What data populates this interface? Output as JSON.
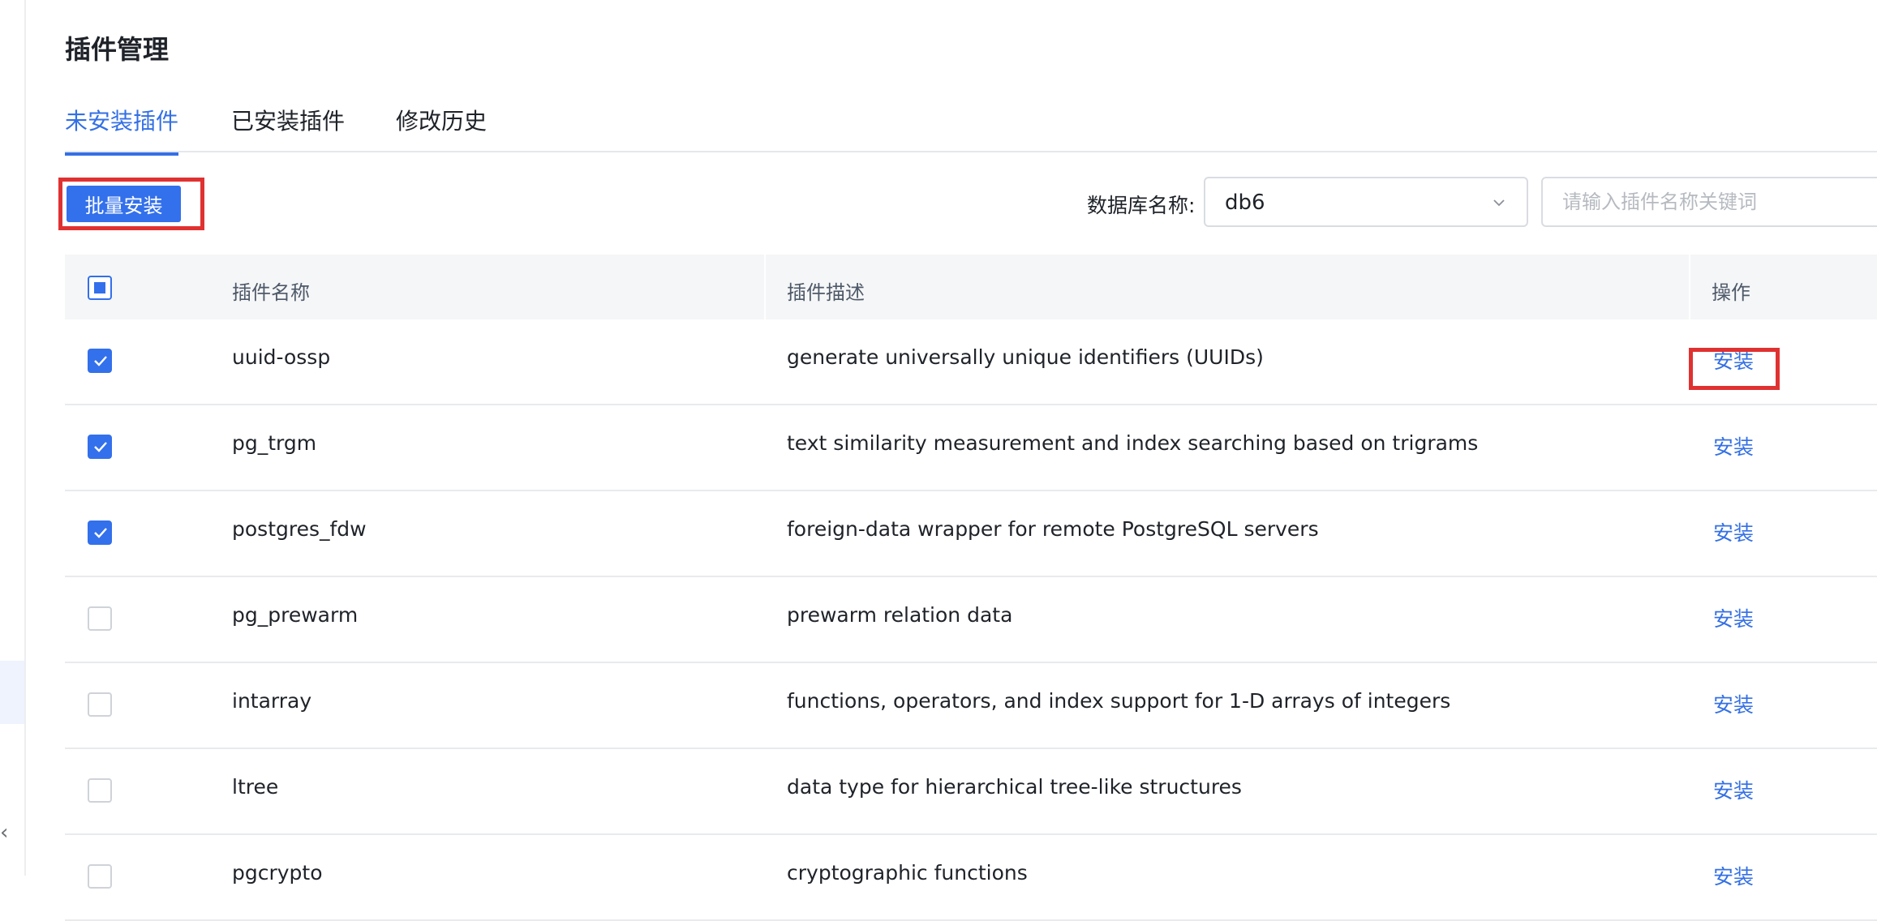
{
  "page": {
    "title": "插件管理"
  },
  "tabs": [
    {
      "label": "未安装插件",
      "active": true
    },
    {
      "label": "已安装插件",
      "active": false
    },
    {
      "label": "修改历史",
      "active": false
    }
  ],
  "toolbar": {
    "batch_install_label": "批量安装",
    "db_label": "数据库名称:",
    "db_value": "db6",
    "search_placeholder": "请输入插件名称关键词"
  },
  "table": {
    "headers": {
      "name": "插件名称",
      "desc": "插件描述",
      "op": "操作"
    },
    "header_checkbox_state": "partial",
    "rows": [
      {
        "name": "uuid-ossp",
        "desc": "generate universally unique identifiers (UUIDs)",
        "op": "安装",
        "checked": true
      },
      {
        "name": "pg_trgm",
        "desc": "text similarity measurement and index searching based on trigrams",
        "op": "安装",
        "checked": true
      },
      {
        "name": "postgres_fdw",
        "desc": "foreign-data wrapper for remote PostgreSQL servers",
        "op": "安装",
        "checked": true
      },
      {
        "name": "pg_prewarm",
        "desc": "prewarm relation data",
        "op": "安装",
        "checked": false
      },
      {
        "name": "intarray",
        "desc": "functions, operators, and index support for 1-D arrays of integers",
        "op": "安装",
        "checked": false
      },
      {
        "name": "ltree",
        "desc": "data type for hierarchical tree-like structures",
        "op": "安装",
        "checked": false
      },
      {
        "name": "pgcrypto",
        "desc": "cryptographic functions",
        "op": "安装",
        "checked": false
      }
    ]
  },
  "colors": {
    "accent": "#3370eb",
    "highlight": "#e03131",
    "link": "#3470e4"
  }
}
